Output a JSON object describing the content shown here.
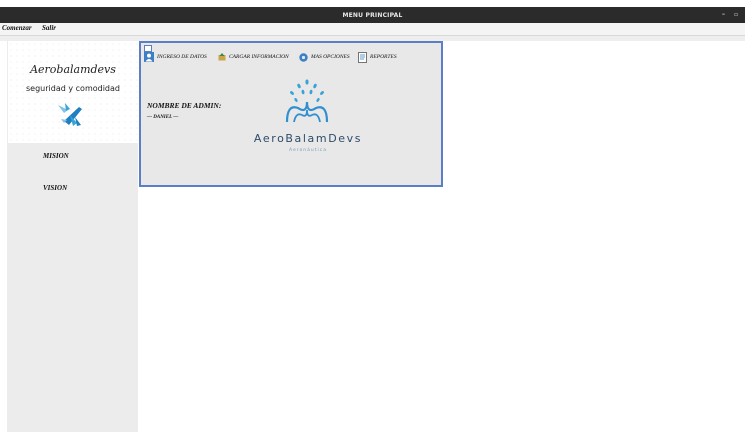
{
  "window": {
    "title": "MENU PRINCIPAL",
    "controls": [
      "–",
      "▫"
    ]
  },
  "menubar": {
    "items": [
      "Comenzar",
      "Salir"
    ]
  },
  "sidebar": {
    "brand_script": "Aerobalamdevs",
    "brand_tagline": "seguridad y comodidad",
    "links": [
      "MISION",
      "VISION"
    ]
  },
  "inner_frame": {
    "toolbar": [
      "INGRESO DE DATOS",
      "CARGAR INFORMACION",
      "MAS OPCIONES",
      "REPORTES"
    ],
    "admin_label": "NOMBRE DE ADMIN:",
    "admin_name": "— DANIEL —",
    "company_name": "AeroBalamDevs",
    "company_sub": "Aeronáutica"
  },
  "colors": {
    "titlebar": "#2b2b2b",
    "frame_border": "#5b7fc7",
    "brand_blue": "#38a3d8"
  }
}
